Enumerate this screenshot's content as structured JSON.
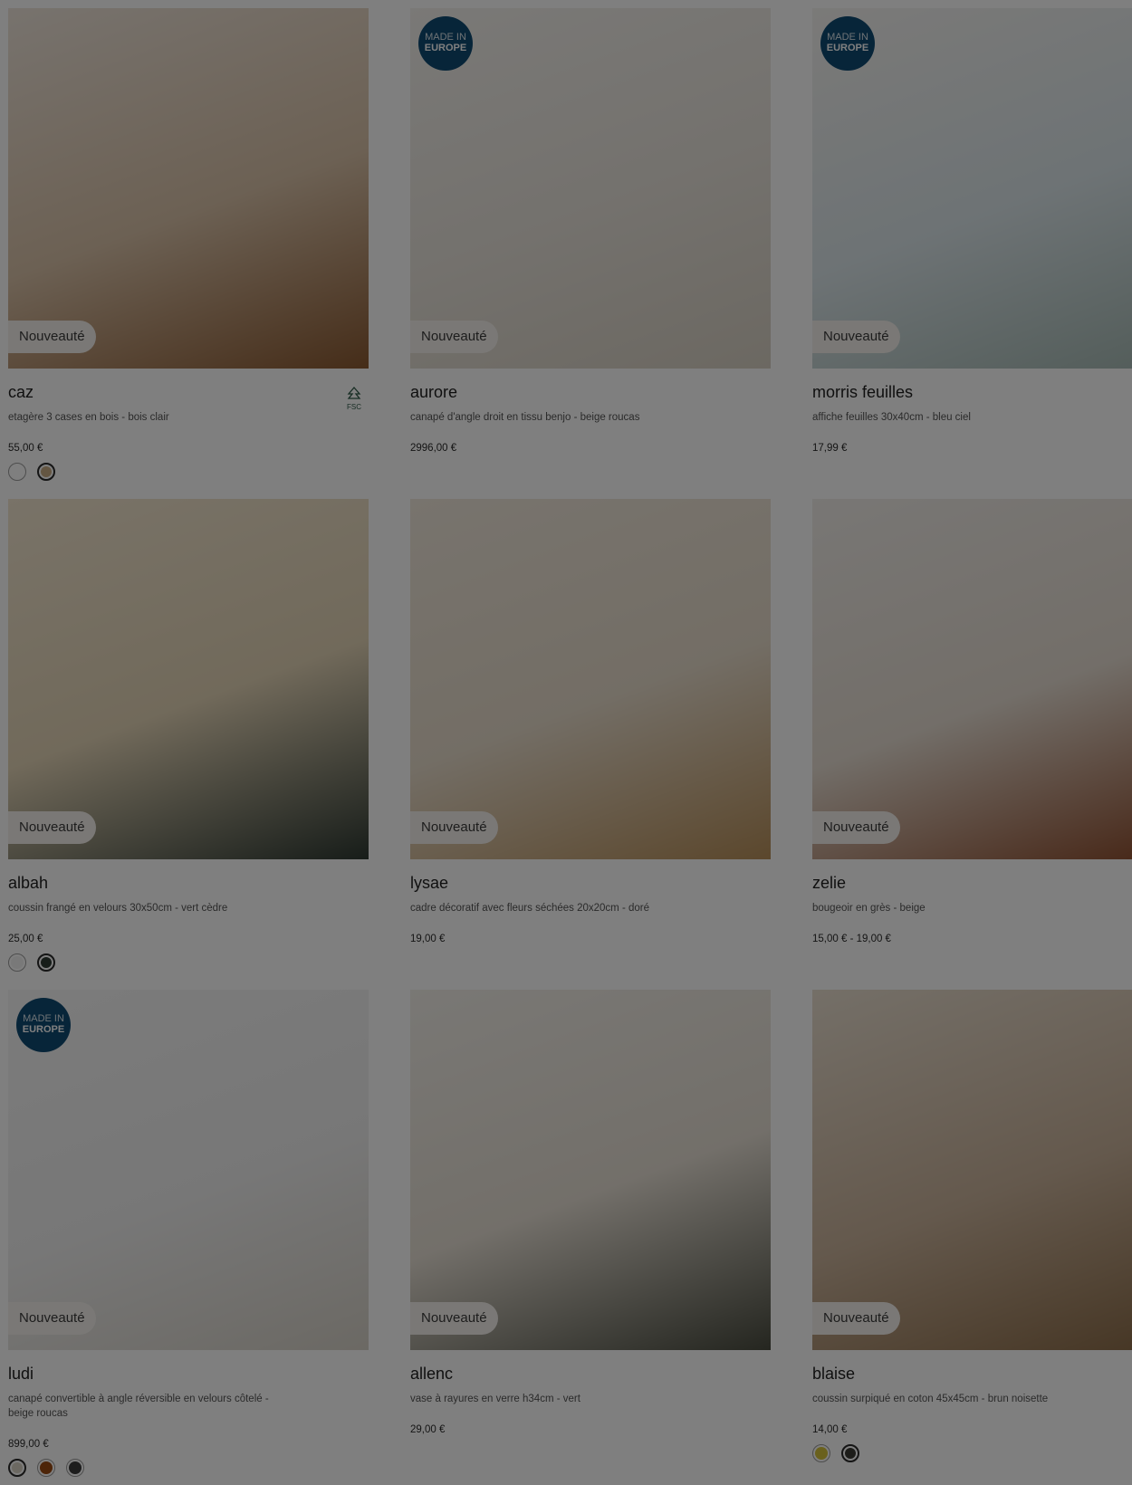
{
  "badges": {
    "new": "Nouveauté",
    "made_in_line1": "MADE IN",
    "made_in_line2": "EUROPE",
    "fsc": "FSC"
  },
  "products": [
    {
      "name": "caz",
      "desc": "etagère 3 cases en bois - bois clair",
      "price": "55,00 €",
      "made_in_europe": false,
      "fsc": true,
      "swatches": [
        "#ffffff",
        "#c9ac84"
      ],
      "selected_swatch": 1,
      "image_colors": [
        "#efe6dc",
        "#d9c2a8",
        "#8b5a32"
      ]
    },
    {
      "name": "aurore",
      "desc": "canapé d'angle droit en tissu benjo - beige roucas",
      "price": "2996,00 €",
      "made_in_europe": true,
      "fsc": false,
      "swatches": [],
      "image_colors": [
        "#f4f2ee",
        "#e8e3db",
        "#d8d1c4"
      ]
    },
    {
      "name": "morris feuilles",
      "desc": "affiche feuilles 30x40cm - bleu ciel",
      "price": "17,99 €",
      "made_in_europe": true,
      "fsc": false,
      "swatches": [],
      "image_colors": [
        "#f6f4f1",
        "#dbe6ea",
        "#a5b9b3"
      ]
    },
    {
      "name": "albah",
      "desc": "coussin frangé en velours 30x50cm - vert cèdre",
      "price": "25,00 €",
      "made_in_europe": false,
      "fsc": false,
      "swatches": [
        "#f2f2f2",
        "#2f3a33"
      ],
      "selected_swatch": 1,
      "image_colors": [
        "#f2e6d0",
        "#e3d4b6",
        "#2f3a33"
      ]
    },
    {
      "name": "lysae",
      "desc": "cadre décoratif avec fleurs séchées 20x20cm - doré",
      "price": "19,00 €",
      "made_in_europe": false,
      "fsc": false,
      "swatches": [],
      "image_colors": [
        "#f0e8dc",
        "#e7dccb",
        "#b78f5a"
      ]
    },
    {
      "name": "zelie",
      "desc": "bougeoir en grès - beige",
      "price": "15,00 € - 19,00 €",
      "made_in_europe": false,
      "fsc": false,
      "swatches": [],
      "image_colors": [
        "#f1eeea",
        "#e6ddd2",
        "#8c4a2a"
      ]
    },
    {
      "name": "ludi",
      "desc": "canapé convertible à angle réversible en velours côtelé - beige roucas",
      "price": "899,00 €",
      "made_in_europe": true,
      "fsc": false,
      "swatches": [
        "#d8d2c4",
        "#9a4a12",
        "#3a3a3a"
      ],
      "selected_swatch": 0,
      "image_colors": [
        "#f7f7f7",
        "#efefef",
        "#d7d2c8"
      ]
    },
    {
      "name": "allenc",
      "desc": "vase à rayures en verre h34cm - vert",
      "price": "29,00 €",
      "made_in_europe": false,
      "fsc": false,
      "swatches": [],
      "image_colors": [
        "#f3f0ea",
        "#e6dfd4",
        "#4a4c40"
      ]
    },
    {
      "name": "blaise",
      "desc": "coussin surpiqué en coton 45x45cm - brun noisette",
      "price": "14,00 €",
      "made_in_europe": false,
      "fsc": false,
      "swatches": [
        "#d4c33a",
        "#3a3a34"
      ],
      "selected_swatch": 1,
      "image_colors": [
        "#e9dfd0",
        "#c9b29a",
        "#8a6a46"
      ]
    }
  ]
}
